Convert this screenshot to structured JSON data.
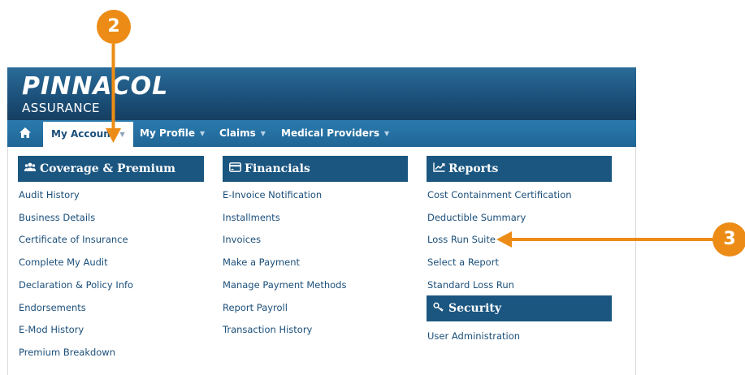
{
  "brand": {
    "name": "PINNACOL",
    "sub": "ASSURANCE"
  },
  "nav": {
    "home_icon": "home-icon",
    "items": [
      {
        "label": "My Account",
        "active": true
      },
      {
        "label": "My Profile"
      },
      {
        "label": "Claims"
      },
      {
        "label": "Medical Providers"
      }
    ]
  },
  "columns": {
    "coverage": {
      "title": "Coverage & Premium",
      "icon": "users-icon",
      "links": [
        "Audit History",
        "Business Details",
        "Certificate of Insurance",
        "Complete My Audit",
        "Declaration & Policy Info",
        "Endorsements",
        "E-Mod History",
        "Premium Breakdown"
      ]
    },
    "financials": {
      "title": "Financials",
      "icon": "credit-card-icon",
      "links": [
        "E-Invoice Notification",
        "Installments",
        "Invoices",
        "Make a Payment",
        "Manage Payment Methods",
        "Report Payroll",
        "Transaction History"
      ]
    },
    "reports": {
      "title": "Reports",
      "icon": "line-chart-icon",
      "links": [
        "Cost Containment Certification",
        "Deductible Summary",
        "Loss Run Suite",
        "Select a Report",
        "Standard Loss Run"
      ]
    },
    "security": {
      "title": "Security",
      "icon": "key-icon",
      "links": [
        "User Administration"
      ]
    }
  },
  "callouts": {
    "step2": "2",
    "step3": "3",
    "color": "#ec8c16"
  },
  "colors": {
    "header": "#1b4f78",
    "nav": "#2474a6",
    "section": "#1b5680",
    "link": "#1b4f7a"
  }
}
